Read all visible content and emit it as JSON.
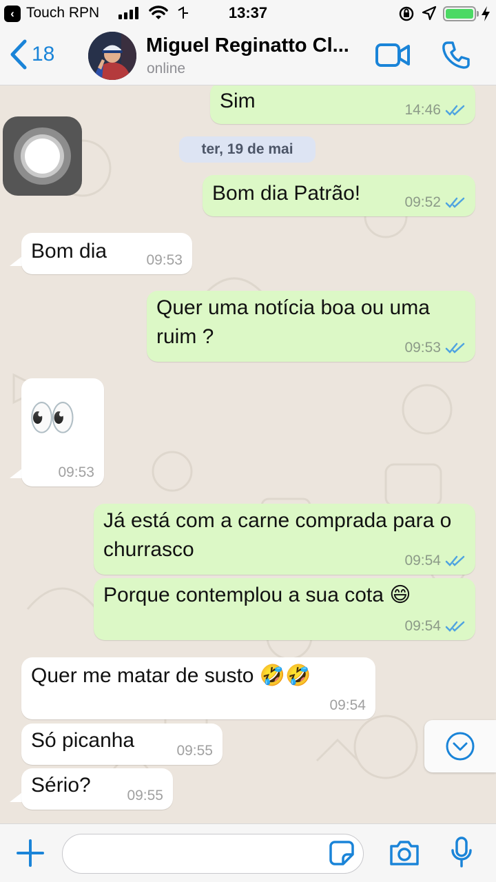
{
  "status_bar": {
    "back_glyph": "‹",
    "carrier": "Touch RPN",
    "time": "13:37",
    "icons": [
      "signal-icon",
      "wifi-icon",
      "location-icon",
      "rotation-lock-icon",
      "navigation-arrow-icon",
      "battery-icon",
      "charging-bolt-icon"
    ],
    "battery_color": "#4cd964"
  },
  "header": {
    "back_count": "18",
    "contact_name": "Miguel Reginatto Cl...",
    "contact_status": "online",
    "accent_color": "#1a84d8"
  },
  "date_separator": "ter, 19 de mai",
  "messages": [
    {
      "dir": "out",
      "text": "Sim",
      "time": "14:46"
    },
    {
      "dir": "out",
      "text": "Bom dia Patrão!",
      "time": "09:52"
    },
    {
      "dir": "in",
      "text": "Bom dia",
      "time": "09:53"
    },
    {
      "dir": "out",
      "text": "Quer uma notícia boa ou uma ruim ?",
      "time": "09:53"
    },
    {
      "dir": "in",
      "text": "👀",
      "time": "09:53"
    },
    {
      "dir": "out",
      "text": "Já está com a carne comprada para o churrasco",
      "time": "09:54"
    },
    {
      "dir": "out",
      "text": "Porque contemplou a sua cota 😄",
      "time": "09:54"
    },
    {
      "dir": "in",
      "text": "Quer me matar de susto 🤣🤣",
      "time": "09:54"
    },
    {
      "dir": "in",
      "text": "Só picanha",
      "time": "09:55"
    },
    {
      "dir": "in",
      "text": "Sério?",
      "time": "09:55"
    }
  ],
  "colors": {
    "outgoing_bubble": "#dcf8c6",
    "incoming_bubble": "#ffffff",
    "read_ticks": "#4fa3e0",
    "chat_background": "#ece5dd"
  },
  "input": {
    "value": "",
    "placeholder": ""
  }
}
